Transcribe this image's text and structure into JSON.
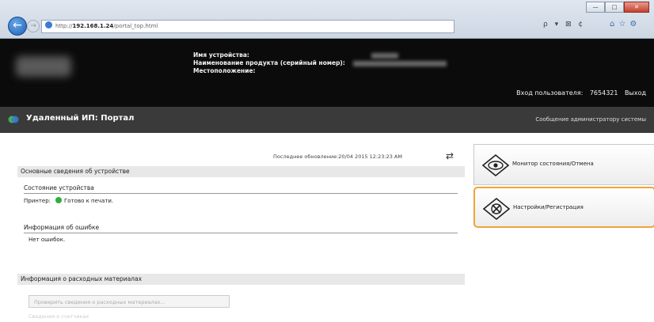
{
  "browser": {
    "url_prefix": "http://",
    "url_host": "192.168.1.24",
    "url_path": "/portal_top.html",
    "search_placeholder": "ρ ▾ ⊠ ¢",
    "window_buttons": [
      "—",
      "□",
      "✕"
    ]
  },
  "device": {
    "name_label": "Имя устройства:",
    "product_label": "Наименование продукта (серийный номер):",
    "location_label": "Местоположение:",
    "login_label": "Вход пользователя:",
    "login_user": "7654321",
    "logout_label": "Выход"
  },
  "titlebar": {
    "title": "Удаленный ИП: Портал",
    "admin_message": "Сообщение администратору системы"
  },
  "main": {
    "last_update": "Последнее обновление:20/04 2015 12:23:23 AM",
    "basic_info_header": "Основные сведения об устройстве",
    "device_status_label": "Состояние устройства",
    "printer_label": "Принтер:",
    "printer_status": "Готово к печати.",
    "error_info_label": "Информация об ошибке",
    "error_text": "Нет ошибок.",
    "consumables_header": "Информация о расходных материалах",
    "check_consumables_button": "Проверить сведения о расходных материалах...",
    "counters_label": "Сведения о счетчиках"
  },
  "menu": {
    "status_monitor": "Монитор состояния/Отмена",
    "settings": "Настройки/Регистрация"
  },
  "colors": {
    "status_ok": "#2fae3b",
    "active_border": "#f0a436",
    "header_bg": "#0b0b0b",
    "titlebar_bg": "#3a3a3a"
  }
}
